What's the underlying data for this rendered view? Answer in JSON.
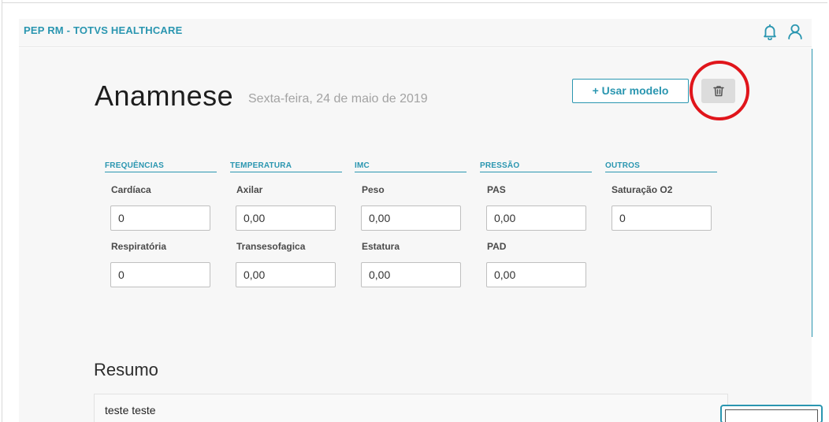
{
  "app": {
    "title": "PEP RM - TOTVS HEALTHCARE"
  },
  "header_icons": {
    "notification": "bell-icon",
    "user": "user-icon"
  },
  "page": {
    "title": "Anamnese",
    "date": "Sexta-feira, 24 de maio de 2019"
  },
  "actions": {
    "use_model_label": "+ Usar modelo",
    "delete_icon": "trash-icon"
  },
  "groups": [
    {
      "label": "FREQUÊNCIAS",
      "fields": [
        {
          "label": "Cardíaca",
          "value": "0"
        },
        {
          "label": "Respiratória",
          "value": "0"
        }
      ]
    },
    {
      "label": "TEMPERATURA",
      "fields": [
        {
          "label": "Axilar",
          "value": "0,00"
        },
        {
          "label": "Transesofagica",
          "value": "0,00"
        }
      ]
    },
    {
      "label": "IMC",
      "fields": [
        {
          "label": "Peso",
          "value": "0,00"
        },
        {
          "label": "Estatura",
          "value": "0,00"
        }
      ]
    },
    {
      "label": "PRESSÃO",
      "fields": [
        {
          "label": "PAS",
          "value": "0,00"
        },
        {
          "label": "PAD",
          "value": "0,00"
        }
      ]
    },
    {
      "label": "OUTROS",
      "fields": [
        {
          "label": "Saturação O2",
          "value": "0"
        }
      ]
    }
  ],
  "summary": {
    "title": "Resumo",
    "text": "teste teste"
  },
  "colors": {
    "accent": "#2a96b0",
    "highlight": "#e0151b",
    "background": "#f7f7f7"
  }
}
